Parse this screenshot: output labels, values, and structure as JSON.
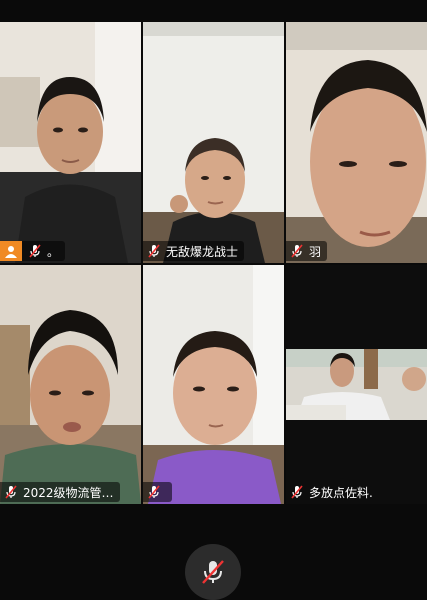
{
  "participants": [
    {
      "name": "。",
      "muted": true,
      "has_avatar_badge": true
    },
    {
      "name": "无敌爆龙战士",
      "muted": true
    },
    {
      "name": "羽",
      "muted": true
    },
    {
      "name": "2022级物流管…",
      "muted": true
    },
    {
      "name": "",
      "muted": true
    },
    {
      "name": "多放点佐料.",
      "muted": true
    }
  ],
  "controls": {
    "mic_icon": "mic-muted-icon"
  },
  "colors": {
    "avatar_badge": "#f08a24",
    "background": "#0a0a0a"
  }
}
